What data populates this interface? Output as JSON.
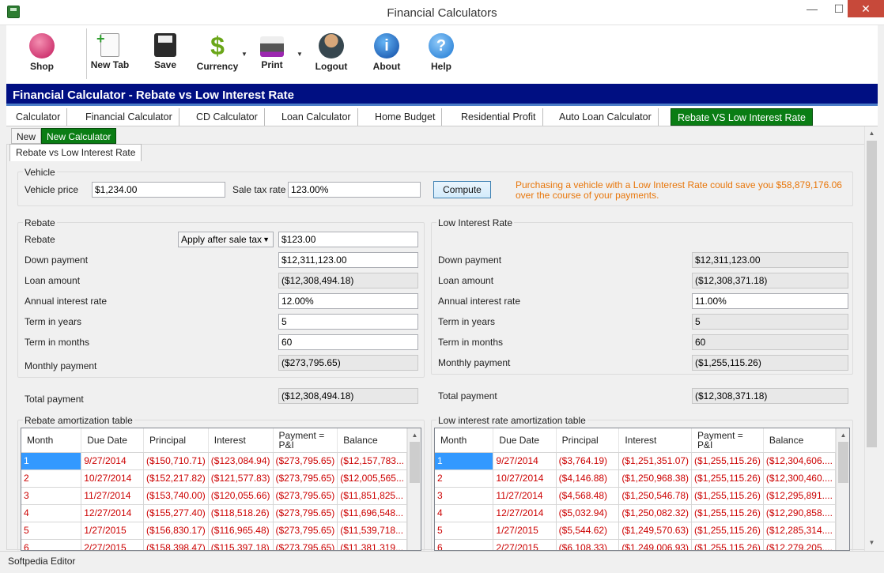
{
  "window": {
    "title": "Financial Calculators",
    "minimize": "—",
    "maximize": "☐",
    "close": "✕"
  },
  "toolbar": [
    {
      "label": "Shop",
      "icon": "shop-icon",
      "color": "#c2185b"
    },
    {
      "label": "New Tab",
      "icon": "new-tab-icon",
      "color": "#4caf50"
    },
    {
      "label": "Save",
      "icon": "save-icon",
      "color": "#333333"
    },
    {
      "label": "Currency",
      "icon": "dollar-icon",
      "color": "#6aa618"
    },
    {
      "label": "Print",
      "icon": "printer-icon",
      "color": "#555555"
    },
    {
      "label": "Logout",
      "icon": "user-icon",
      "color": "#5d4037"
    },
    {
      "label": "About",
      "icon": "info-icon",
      "color": "#1565c0"
    },
    {
      "label": "Help",
      "icon": "help-icon",
      "color": "#1e88e5"
    }
  ],
  "banner": "Financial Calculator - Rebate vs Low Interest Rate",
  "tabs": [
    "Calculator",
    "Financial Calculator",
    "CD Calculator",
    "Loan Calculator",
    "Home Budget",
    "Residential Profit",
    "Auto Loan Calculator",
    "Rebate VS Low Interest Rate"
  ],
  "subtabs": [
    "New",
    "New Calculator"
  ],
  "panel_tab": "Rebate vs Low Interest Rate",
  "vehicle": {
    "group": "Vehicle",
    "price_label": "Vehicle price",
    "price": "$1,234.00",
    "tax_label": "Sale tax rate",
    "tax": "123.00%",
    "compute": "Compute",
    "note": "Purchasing a vehicle with a Low Interest Rate could save you $58,879,176.06 over the course of your payments."
  },
  "rebate": {
    "group": "Rebate",
    "rebate_label": "Rebate",
    "rebate_option": "Apply after sale tax",
    "rebate_value": "$123.00",
    "down_label": "Down payment",
    "down": "$12,311,123.00",
    "loan_label": "Loan amount",
    "loan": "($12,308,494.18)",
    "rate_label": "Annual interest rate",
    "rate": "12.00%",
    "years_label": "Term in years",
    "years": "5",
    "months_label": "Term in months",
    "months": "60",
    "monthly_label": "Monthly payment",
    "monthly": "($273,795.65)",
    "total_label": "Total payment",
    "total": "($12,308,494.18)"
  },
  "low": {
    "group": "Low Interest Rate",
    "down_label": "Down payment",
    "down": "$12,311,123.00",
    "loan_label": "Loan amount",
    "loan": "($12,308,371.18)",
    "rate_label": "Annual interest rate",
    "rate": "11.00%",
    "years_label": "Term in years",
    "years": "5",
    "months_label": "Term in months",
    "months": "60",
    "monthly_label": "Monthly payment",
    "monthly": "($1,255,115.26)",
    "total_label": "Total payment",
    "total": "($12,308,371.18)"
  },
  "rebate_table": {
    "title": "Rebate amortization table",
    "columns": [
      "Month",
      "Due Date",
      "Principal",
      "Interest",
      "Payment = P&I",
      "Balance"
    ],
    "rows": [
      [
        "1",
        "9/27/2014",
        "($150,710.71)",
        "($123,084.94)",
        "($273,795.65)",
        "($12,157,783..."
      ],
      [
        "2",
        "10/27/2014",
        "($152,217.82)",
        "($121,577.83)",
        "($273,795.65)",
        "($12,005,565..."
      ],
      [
        "3",
        "11/27/2014",
        "($153,740.00)",
        "($120,055.66)",
        "($273,795.65)",
        "($11,851,825..."
      ],
      [
        "4",
        "12/27/2014",
        "($155,277.40)",
        "($118,518.26)",
        "($273,795.65)",
        "($11,696,548..."
      ],
      [
        "5",
        "1/27/2015",
        "($156,830.17)",
        "($116,965.48)",
        "($273,795.65)",
        "($11,539,718..."
      ],
      [
        "6",
        "2/27/2015",
        "($158,398.47)",
        "($115,397.18)",
        "($273,795.65)",
        "($11,381,319..."
      ]
    ]
  },
  "low_table": {
    "title": "Low interest rate amortization table",
    "columns": [
      "Month",
      "Due Date",
      "Principal",
      "Interest",
      "Payment = P&I",
      "Balance"
    ],
    "rows": [
      [
        "1",
        "9/27/2014",
        "($3,764.19)",
        "($1,251,351.07)",
        "($1,255,115.26)",
        "($12,304,606...."
      ],
      [
        "2",
        "10/27/2014",
        "($4,146.88)",
        "($1,250,968.38)",
        "($1,255,115.26)",
        "($12,300,460...."
      ],
      [
        "3",
        "11/27/2014",
        "($4,568.48)",
        "($1,250,546.78)",
        "($1,255,115.26)",
        "($12,295,891...."
      ],
      [
        "4",
        "12/27/2014",
        "($5,032.94)",
        "($1,250,082.32)",
        "($1,255,115.26)",
        "($12,290,858...."
      ],
      [
        "5",
        "1/27/2015",
        "($5,544.62)",
        "($1,249,570.63)",
        "($1,255,115.26)",
        "($12,285,314...."
      ],
      [
        "6",
        "2/27/2015",
        "($6,108.33)",
        "($1,249,006.93)",
        "($1,255,115.26)",
        "($12,279,205...."
      ]
    ]
  },
  "status": "Softpedia Editor"
}
